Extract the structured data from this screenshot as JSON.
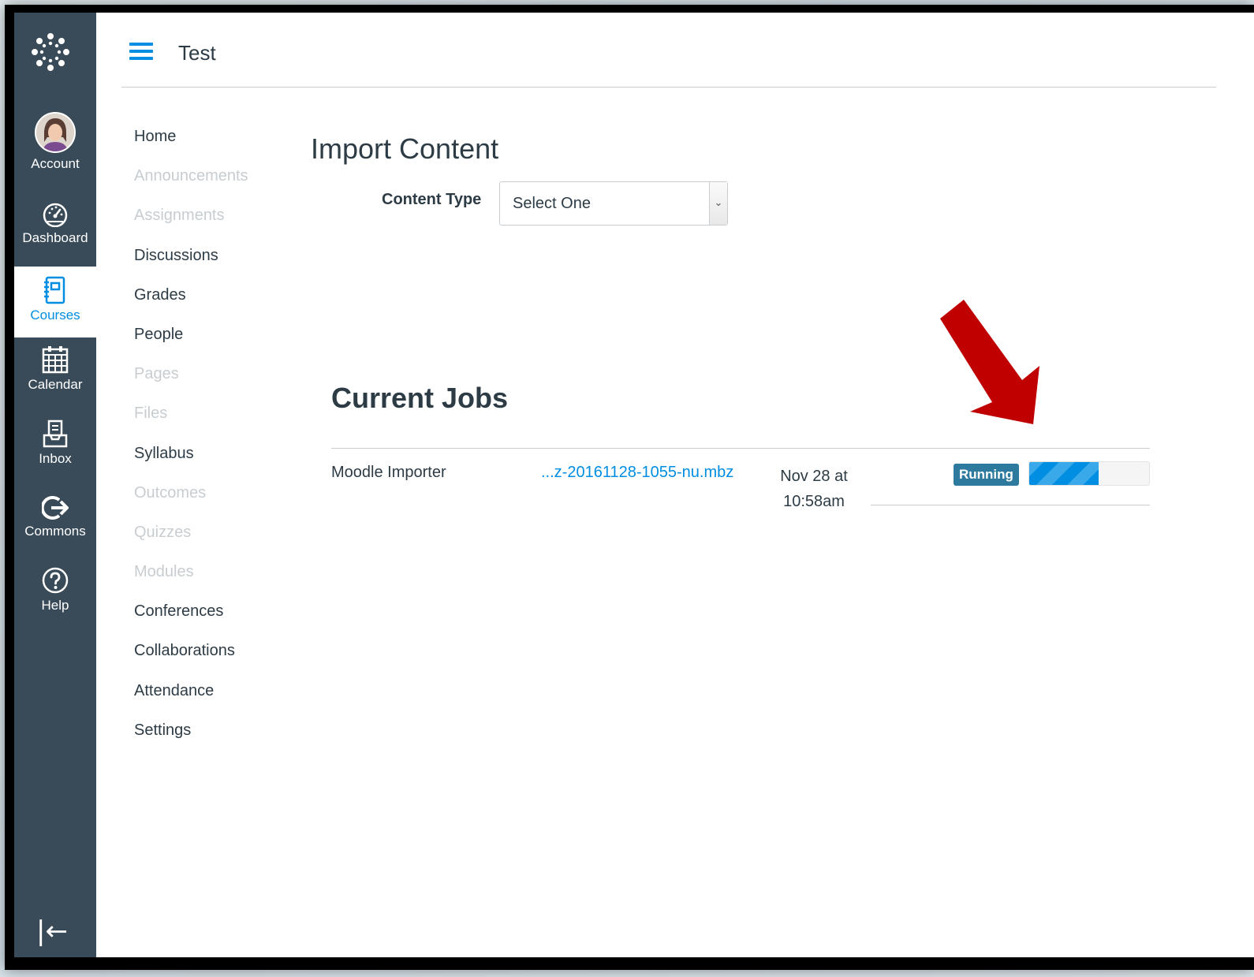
{
  "global_nav": {
    "logo_icon": "canvas-logo-icon",
    "items": [
      {
        "label": "Account",
        "icon": "avatar"
      },
      {
        "label": "Dashboard",
        "icon": "speedometer-icon"
      },
      {
        "label": "Courses",
        "icon": "book-icon",
        "active": true
      },
      {
        "label": "Calendar",
        "icon": "calendar-icon"
      },
      {
        "label": "Inbox",
        "icon": "inbox-icon"
      },
      {
        "label": "Commons",
        "icon": "commons-arrow-icon"
      },
      {
        "label": "Help",
        "icon": "help-circle-icon"
      }
    ],
    "collapse_icon": "|←"
  },
  "header": {
    "course_title": "Test",
    "menu_icon": "hamburger-icon"
  },
  "course_nav": {
    "items": [
      {
        "label": "Home",
        "enabled": true
      },
      {
        "label": "Announcements",
        "enabled": false
      },
      {
        "label": "Assignments",
        "enabled": false
      },
      {
        "label": "Discussions",
        "enabled": true
      },
      {
        "label": "Grades",
        "enabled": true
      },
      {
        "label": "People",
        "enabled": true
      },
      {
        "label": "Pages",
        "enabled": false
      },
      {
        "label": "Files",
        "enabled": false
      },
      {
        "label": "Syllabus",
        "enabled": true
      },
      {
        "label": "Outcomes",
        "enabled": false
      },
      {
        "label": "Quizzes",
        "enabled": false
      },
      {
        "label": "Modules",
        "enabled": false
      },
      {
        "label": "Conferences",
        "enabled": true
      },
      {
        "label": "Collaborations",
        "enabled": true
      },
      {
        "label": "Attendance",
        "enabled": true
      },
      {
        "label": "Settings",
        "enabled": true
      }
    ]
  },
  "main": {
    "title": "Import Content",
    "content_type_label": "Content Type",
    "content_type_value": "Select One",
    "select_arrow": "⌄"
  },
  "jobs": {
    "title": "Current Jobs",
    "rows": [
      {
        "name": "Moodle Importer",
        "file": "...z-20161128-1055-nu.mbz",
        "date_line1": "Nov 28 at",
        "date_line2": "10:58am",
        "status": "Running",
        "progress": 0.58
      }
    ]
  },
  "colors": {
    "global_nav_bg": "#394b58",
    "accent": "#008ee2",
    "badge": "#2d7a9e",
    "annotation_arrow": "#c00000"
  }
}
